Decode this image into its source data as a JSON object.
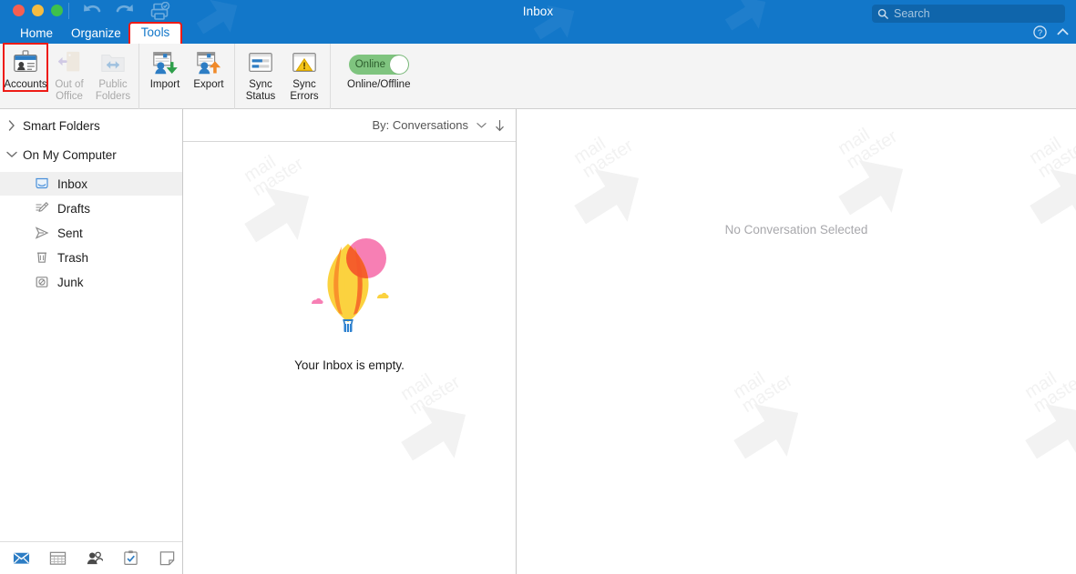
{
  "window": {
    "title": "Inbox",
    "traffic_lights": [
      "close",
      "minimize",
      "zoom"
    ],
    "quick_icons": [
      "undo-icon",
      "redo-icon",
      "print-preview-icon"
    ]
  },
  "search": {
    "placeholder": "Search",
    "value": "",
    "icon": "search-icon"
  },
  "titlebar_right": {
    "help_icon": "help-circle-icon",
    "collapse_icon": "chevron-up-icon"
  },
  "ribbon_tabs": [
    {
      "label": "Home",
      "active": false
    },
    {
      "label": "Organize",
      "active": false
    },
    {
      "label": "Tools",
      "active": true,
      "highlight_color": "#ee1b16"
    }
  ],
  "ribbon": {
    "groups": [
      {
        "name": "accounts-group",
        "buttons": [
          {
            "label": "Accounts",
            "icon": "id-badge-icon",
            "disabled": false,
            "highlighted": true
          },
          {
            "label": "Out of\nOffice",
            "icon": "out-of-office-door-icon",
            "disabled": true,
            "highlighted": false
          },
          {
            "label": "Public\nFolders",
            "icon": "public-folders-icon",
            "disabled": true,
            "highlighted": false
          }
        ]
      },
      {
        "name": "transfer-group",
        "buttons": [
          {
            "label": "Import",
            "icon": "import-contact-down-arrow-icon",
            "disabled": false,
            "highlighted": false
          },
          {
            "label": "Export",
            "icon": "export-contact-up-arrow-icon",
            "disabled": false,
            "highlighted": false
          }
        ]
      },
      {
        "name": "sync-group",
        "buttons": [
          {
            "label": "Sync\nStatus",
            "icon": "sync-status-window-icon",
            "disabled": false,
            "highlighted": false
          },
          {
            "label": "Sync\nErrors",
            "icon": "sync-errors-warning-icon",
            "disabled": false,
            "highlighted": false
          }
        ]
      }
    ],
    "online_toggle": {
      "state_label": "Online",
      "caption": "Online/Offline",
      "on": true,
      "track_color": "#7fc47f"
    }
  },
  "sidebar": {
    "items": [
      {
        "label": "Smart Folders",
        "type": "group",
        "expanded": false,
        "icon": "chevron-right-icon"
      },
      {
        "label": "On My Computer",
        "type": "group",
        "expanded": true,
        "icon": "chevron-down-icon"
      },
      {
        "label": "Inbox",
        "type": "leaf",
        "icon": "inbox-tray-icon",
        "selected": true
      },
      {
        "label": "Drafts",
        "type": "leaf",
        "icon": "drafts-pencil-icon",
        "selected": false
      },
      {
        "label": "Sent",
        "type": "leaf",
        "icon": "sent-paper-plane-icon",
        "selected": false
      },
      {
        "label": "Trash",
        "type": "leaf",
        "icon": "trash-can-icon",
        "selected": false
      },
      {
        "label": "Junk",
        "type": "leaf",
        "icon": "junk-blocked-icon",
        "selected": false
      }
    ],
    "bottom_bar": [
      {
        "name": "mail-icon",
        "active": true
      },
      {
        "name": "calendar-icon",
        "active": false
      },
      {
        "name": "people-icon",
        "active": false
      },
      {
        "name": "tasks-clipboard-icon",
        "active": false
      },
      {
        "name": "notes-icon",
        "active": false
      }
    ]
  },
  "message_list": {
    "sort_label": "By: Conversations",
    "sort_chevron_icon": "chevron-down-icon",
    "sort_direction_icon": "arrow-down-icon",
    "empty_text": "Your Inbox is empty.",
    "empty_illustration": "hot-air-balloon-illustration",
    "items": []
  },
  "reading_pane": {
    "placeholder_text": "No Conversation Selected"
  },
  "watermark": {
    "text_line1": "mail",
    "text_line2": "master",
    "color": "#f1f1f1"
  },
  "colors": {
    "titlebar": "#1277c9",
    "ribbon": "#f4f4f4",
    "accent": "#1277c9",
    "highlight_box": "#ee1b16",
    "selected_row": "#f0f0f0",
    "muted_text": "#a8a8ac"
  }
}
